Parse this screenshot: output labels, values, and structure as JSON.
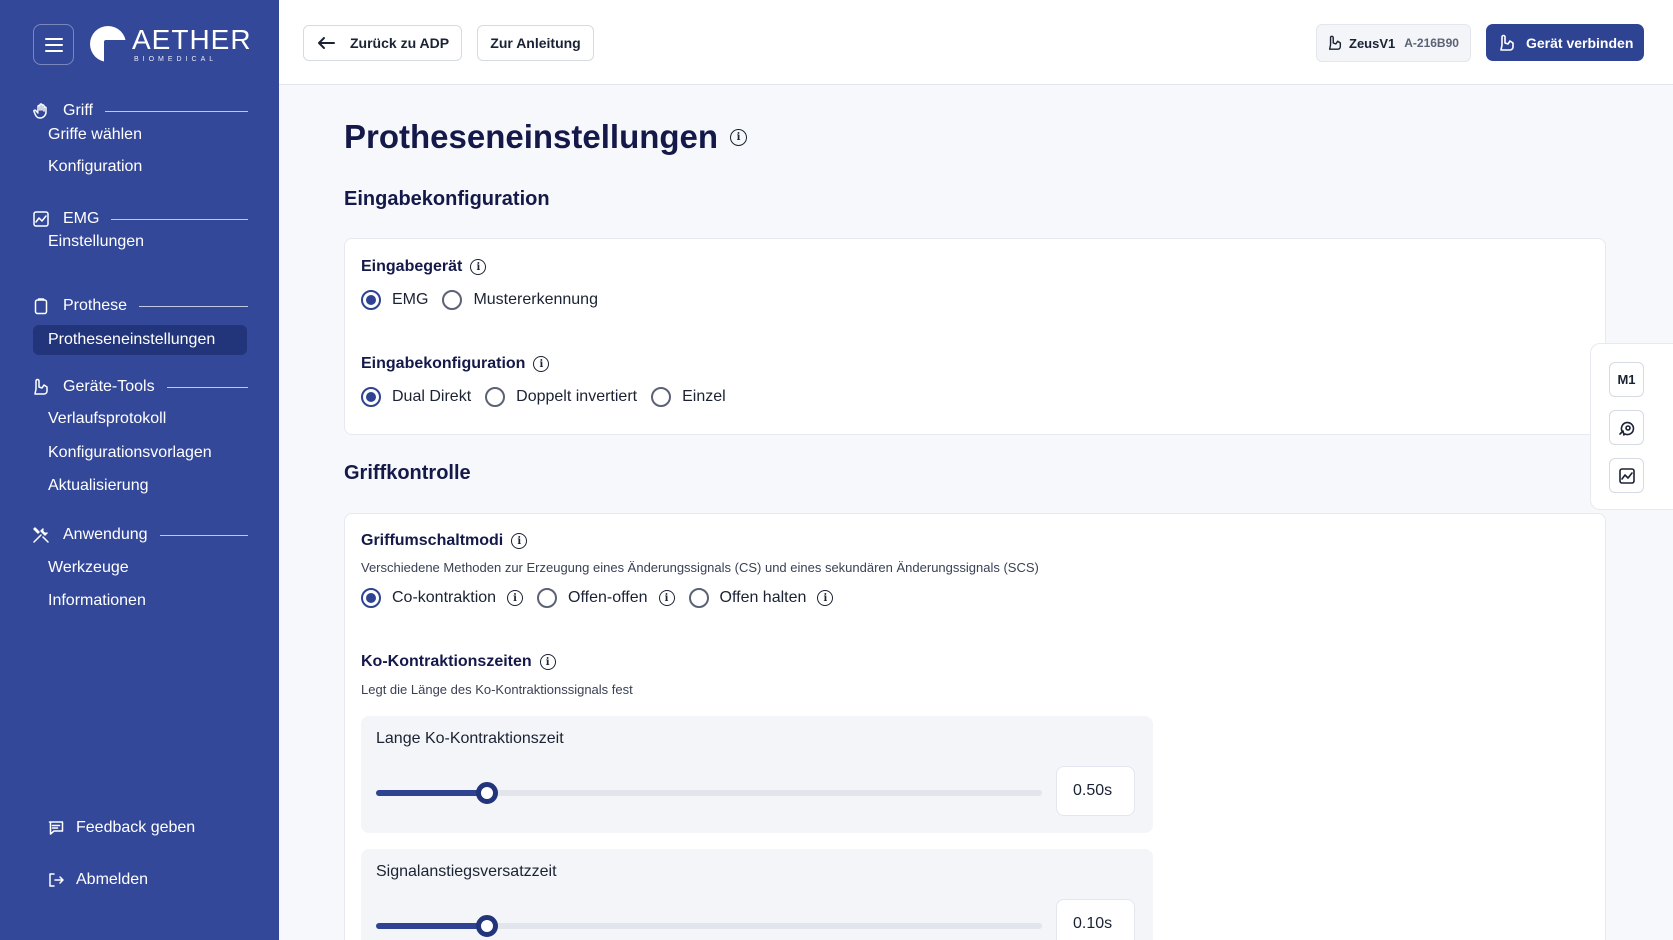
{
  "sidebar": {
    "brand": {
      "word": "AETHER",
      "sub": "BIOMEDICAL"
    },
    "groups": [
      {
        "label": "Griff",
        "icon": "hand-icon",
        "items": [
          "Griffe wählen",
          "Konfiguration"
        ]
      },
      {
        "label": "EMG",
        "icon": "chart-icon",
        "items": [
          "Einstellungen"
        ]
      },
      {
        "label": "Prothese",
        "icon": "clipboard-icon",
        "items": [
          "Protheseneinstellungen"
        ]
      },
      {
        "label": "Geräte-Tools",
        "icon": "prosthesis-icon",
        "items": [
          "Verlaufsprotokoll",
          "Konfigurationsvorlagen",
          "Aktualisierung"
        ]
      },
      {
        "label": "Anwendung",
        "icon": "tools-icon",
        "items": [
          "Werkzeuge",
          "Informationen"
        ]
      }
    ],
    "active_item": "Protheseneinstellungen",
    "feedback": "Feedback geben",
    "logout": "Abmelden"
  },
  "topbar": {
    "back_label": "Zurück zu ADP",
    "guide_label": "Zur Anleitung",
    "device_name": "ZeusV1",
    "device_serial": "A-216B90",
    "connect_label": "Gerät verbinden"
  },
  "main": {
    "title": "Protheseneinstellungen",
    "input_section": {
      "title": "Eingabekonfiguration",
      "device_label": "Eingabegerät",
      "device_options": [
        "EMG",
        "Mustererkennung"
      ],
      "device_selected": "EMG",
      "config_label": "Eingabekonfiguration",
      "config_options": [
        "Dual Direkt",
        "Doppelt invertiert",
        "Einzel"
      ],
      "config_selected": "Dual Direkt"
    },
    "grip_section": {
      "title": "Griffkontrolle",
      "modes_label": "Griffumschaltmodi",
      "modes_desc": "Verschiedene Methoden zur Erzeugung eines Änderungssignals (CS) und eines sekundären Änderungssignals (SCS)",
      "mode_options": [
        "Co-kontraktion",
        "Offen-offen",
        "Offen halten"
      ],
      "mode_selected": "Co-kontraktion",
      "times_label": "Ko-Kontraktionszeiten",
      "times_desc": "Legt die Länge des Ko-Kontraktionssignals fest",
      "sliders": [
        {
          "label": "Lange Ko-Kontraktionszeit",
          "value": "0.50s",
          "fraction": 0.167
        },
        {
          "label": "Signalanstiegsversatzzeit",
          "value": "0.10s",
          "fraction": 0.167
        }
      ]
    }
  },
  "side_tools": {
    "m1_label": "M1"
  },
  "colors": {
    "sidebar_bg": "#34489a",
    "accent": "#2f4393",
    "active_nav": "#22347a"
  }
}
